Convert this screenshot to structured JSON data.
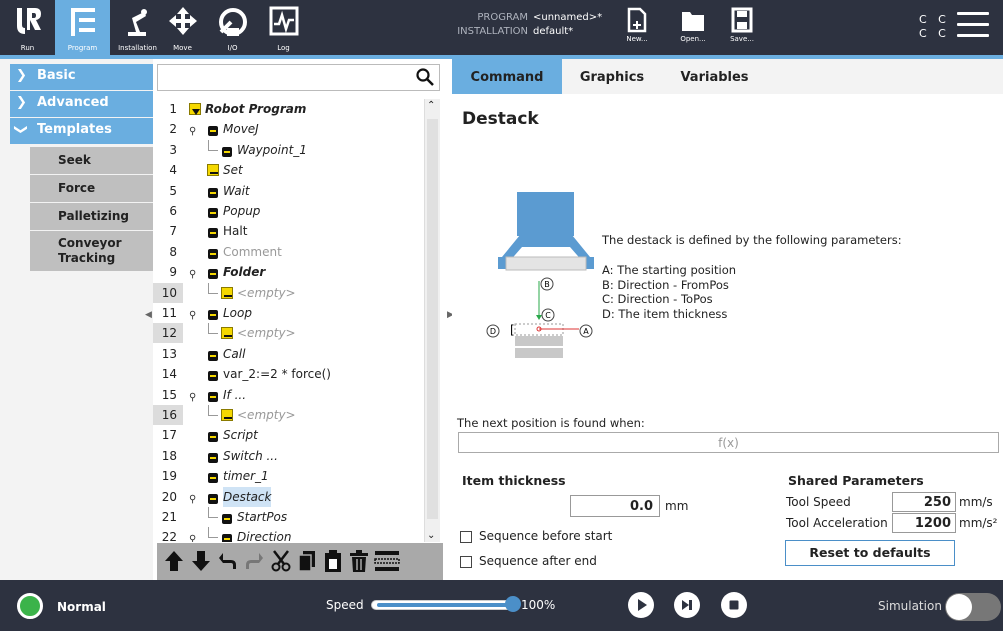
{
  "header": {
    "nav": [
      {
        "label": "Run",
        "icon": "ur-logo-icon"
      },
      {
        "label": "Program",
        "icon": "program-tree-icon"
      },
      {
        "label": "Installation",
        "icon": "robot-arm-icon"
      },
      {
        "label": "Move",
        "icon": "move-arrows-icon"
      },
      {
        "label": "I/O",
        "icon": "io-icon"
      },
      {
        "label": "Log",
        "icon": "log-chart-icon"
      }
    ],
    "program_label": "PROGRAM",
    "program_value": "<unnamed>*",
    "installation_label": "INSTALLATION",
    "installation_value": "default*",
    "file_buttons": [
      {
        "label": "New...",
        "icon": "new-file-icon"
      },
      {
        "label": "Open...",
        "icon": "open-folder-icon"
      },
      {
        "label": "Save...",
        "icon": "save-disk-icon"
      }
    ],
    "cc_line1": "C C",
    "cc_line2": "C C",
    "accent_color": "#6aaee0"
  },
  "sidebar": {
    "categories": [
      {
        "label": "Basic",
        "expanded": false
      },
      {
        "label": "Advanced",
        "expanded": false
      },
      {
        "label": "Templates",
        "expanded": true
      }
    ],
    "template_items": [
      "Seek",
      "Force",
      "Palletizing",
      "Conveyor Tracking"
    ]
  },
  "search": {
    "placeholder": ""
  },
  "tree": [
    {
      "num": "1",
      "label": "Robot Program",
      "icon": "program-flag-icon"
    },
    {
      "num": "2",
      "label": "MoveJ",
      "icon": "move-arrows-icon"
    },
    {
      "num": "3",
      "label": "Waypoint_1",
      "icon": "waypoint-icon"
    },
    {
      "num": "4",
      "label": "Set",
      "icon": "set-icon"
    },
    {
      "num": "5",
      "label": "Wait",
      "icon": "hourglass-icon"
    },
    {
      "num": "6",
      "label": "Popup",
      "icon": "popup-icon"
    },
    {
      "num": "7",
      "label": "Halt",
      "icon": "halt-icon"
    },
    {
      "num": "8",
      "label": "Comment",
      "icon": "comment-icon"
    },
    {
      "num": "9",
      "label": "Folder",
      "icon": "folder-icon"
    },
    {
      "num": "10",
      "label": "<empty>",
      "icon": "empty-icon"
    },
    {
      "num": "11",
      "label": "Loop",
      "icon": "loop-icon"
    },
    {
      "num": "12",
      "label": "<empty>",
      "icon": "empty-icon"
    },
    {
      "num": "13",
      "label": "Call",
      "icon": "call-icon"
    },
    {
      "num": "14",
      "label": "var_2:=2 * force()",
      "icon": "assignment-icon"
    },
    {
      "num": "15",
      "label": "If ...",
      "icon": "if-icon"
    },
    {
      "num": "16",
      "label": "<empty>",
      "icon": "empty-icon"
    },
    {
      "num": "17",
      "label": "Script",
      "icon": "script-icon"
    },
    {
      "num": "18",
      "label": "Switch ...",
      "icon": "switch-icon"
    },
    {
      "num": "19",
      "label": "timer_1",
      "icon": "timer-icon"
    },
    {
      "num": "20",
      "label": "Destack",
      "icon": "destack-icon"
    },
    {
      "num": "21",
      "label": "StartPos",
      "icon": "waypoint-icon"
    },
    {
      "num": "22",
      "label": "Direction",
      "icon": "direction-icon"
    }
  ],
  "tabs": [
    "Command",
    "Graphics",
    "Variables"
  ],
  "command": {
    "title": "Destack",
    "description": "The destack is defined by the following parameters:",
    "params": [
      "A: The starting position",
      "B: Direction - FromPos",
      "C: Direction - ToPos",
      "D: The item thickness"
    ],
    "diagram_labels": [
      "B",
      "C",
      "D",
      "A"
    ],
    "next_position_label": "The next position is found when:",
    "fx_label": "f(x)",
    "item_thickness_title": "Item thickness",
    "item_thickness_value": "0.0",
    "item_thickness_unit": "mm",
    "sequence_before_start": "Sequence before start",
    "sequence_after_end": "Sequence after end",
    "shared_title": "Shared Parameters",
    "tool_speed_label": "Tool Speed",
    "tool_speed_value": "250",
    "tool_speed_unit": "mm/s",
    "tool_accel_label": "Tool Acceleration",
    "tool_accel_value": "1200",
    "tool_accel_unit": "mm/s²",
    "reset_label": "Reset to defaults"
  },
  "footer": {
    "status": "Normal",
    "status_color": "#3bb34a",
    "speed_label": "Speed",
    "speed_value": "100%",
    "speed_fraction": 1.0,
    "simulation_label": "Simulation"
  }
}
